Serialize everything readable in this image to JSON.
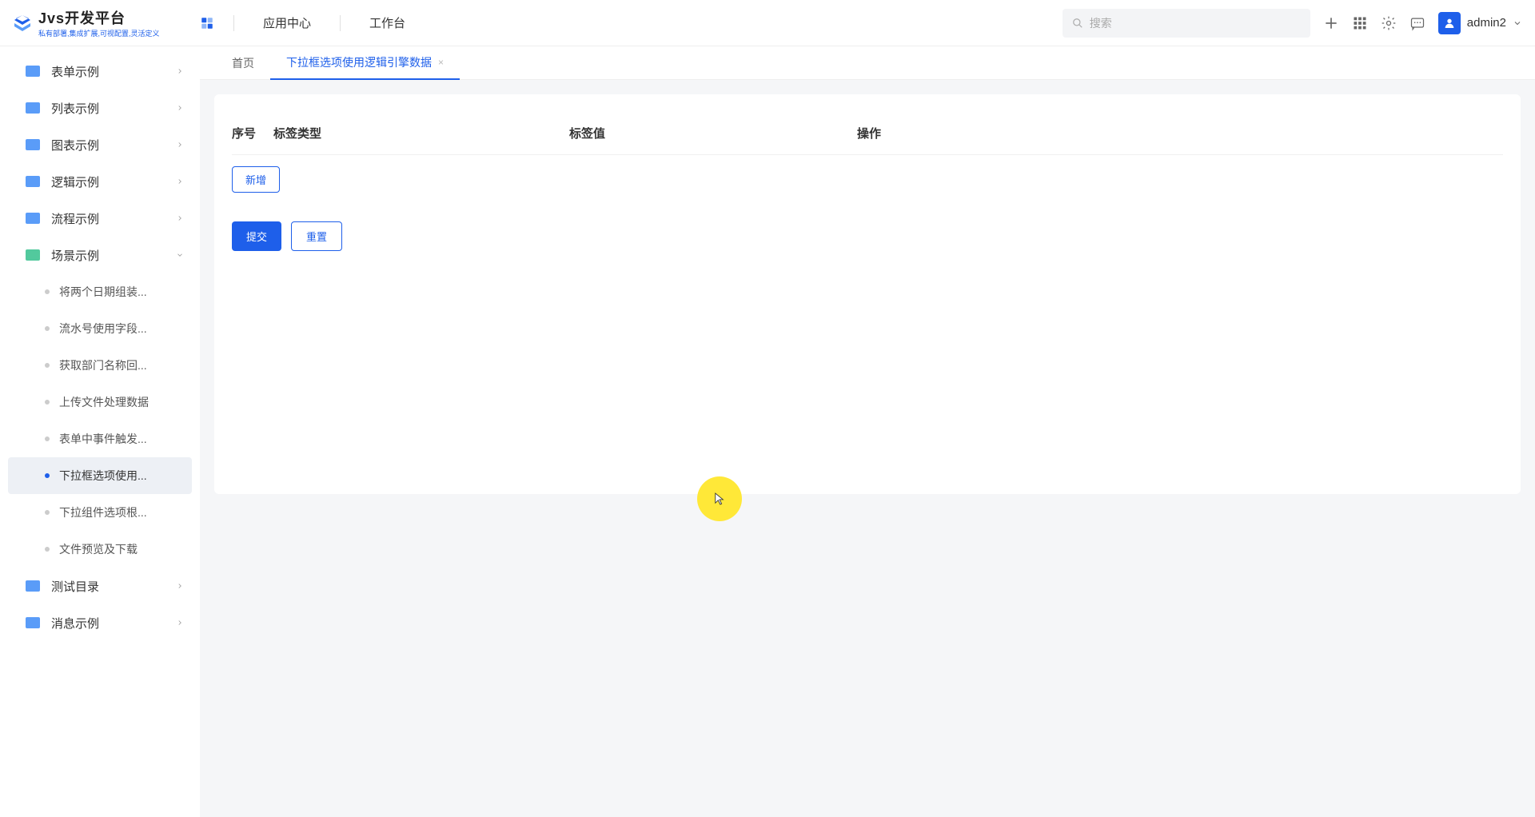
{
  "header": {
    "logo_title": "Jvs开发平台",
    "logo_subtitle": "私有部署,集成扩展,可视配置,灵活定义",
    "nav": {
      "app_center": "应用中心",
      "workspace": "工作台"
    },
    "search_placeholder": "搜索",
    "user_name": "admin2"
  },
  "sidebar": {
    "items": [
      {
        "label": "表单示例",
        "folder": "blue",
        "expandable": true
      },
      {
        "label": "列表示例",
        "folder": "blue",
        "expandable": true
      },
      {
        "label": "图表示例",
        "folder": "blue",
        "expandable": true
      },
      {
        "label": "逻辑示例",
        "folder": "blue",
        "expandable": true
      },
      {
        "label": "流程示例",
        "folder": "blue",
        "expandable": true
      },
      {
        "label": "场景示例",
        "folder": "green",
        "expandable": true,
        "expanded": true,
        "children": [
          {
            "label": "将两个日期组装..."
          },
          {
            "label": "流水号使用字段..."
          },
          {
            "label": "获取部门名称回..."
          },
          {
            "label": "上传文件处理数据"
          },
          {
            "label": "表单中事件触发..."
          },
          {
            "label": "下拉框选项使用...",
            "active": true
          },
          {
            "label": "下拉组件选项根..."
          },
          {
            "label": "文件预览及下载"
          }
        ]
      },
      {
        "label": "测试目录",
        "folder": "blue",
        "expandable": true
      },
      {
        "label": "消息示例",
        "folder": "blue",
        "expandable": true
      }
    ]
  },
  "tabs": [
    {
      "label": "首页",
      "active": false,
      "closable": false
    },
    {
      "label": "下拉框选项使用逻辑引擎数据",
      "active": true,
      "closable": true
    }
  ],
  "content": {
    "table_headers": {
      "index": "序号",
      "type": "标签类型",
      "value": "标签值",
      "action": "操作"
    },
    "add_button": "新增",
    "submit_button": "提交",
    "reset_button": "重置"
  }
}
